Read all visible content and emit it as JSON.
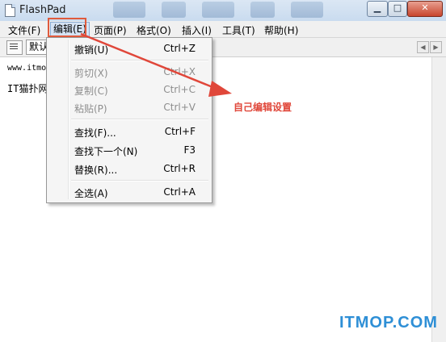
{
  "window": {
    "title": "FlashPad"
  },
  "menubar": {
    "items": [
      "文件(F)",
      "编辑(E)",
      "页面(P)",
      "格式(O)",
      "插入(I)",
      "工具(T)",
      "帮助(H)"
    ],
    "active": "编辑(E)"
  },
  "toolbar": {
    "font_value": "默认"
  },
  "editor": {
    "lines": [
      "www.itmop",
      "IT猫扑网"
    ]
  },
  "edit_menu": {
    "items": [
      {
        "label": "撤销(U)",
        "shortcut": "Ctrl+Z",
        "enabled": true
      },
      {
        "label": "剪切(X)",
        "shortcut": "Ctrl+X",
        "enabled": false
      },
      {
        "label": "复制(C)",
        "shortcut": "Ctrl+C",
        "enabled": false
      },
      {
        "label": "粘贴(P)",
        "shortcut": "Ctrl+V",
        "enabled": false
      },
      {
        "label": "查找(F)...",
        "shortcut": "Ctrl+F",
        "enabled": true
      },
      {
        "label": "查找下一个(N)",
        "shortcut": "F3",
        "enabled": true
      },
      {
        "label": "替换(R)...",
        "shortcut": "Ctrl+R",
        "enabled": true
      },
      {
        "label": "全选(A)",
        "shortcut": "Ctrl+A",
        "enabled": true
      }
    ]
  },
  "annotation": {
    "text": "自己编辑设置",
    "color": "#e0473a"
  },
  "watermark": {
    "text": "ITMOP.COM",
    "color": "#2e8fd6"
  }
}
